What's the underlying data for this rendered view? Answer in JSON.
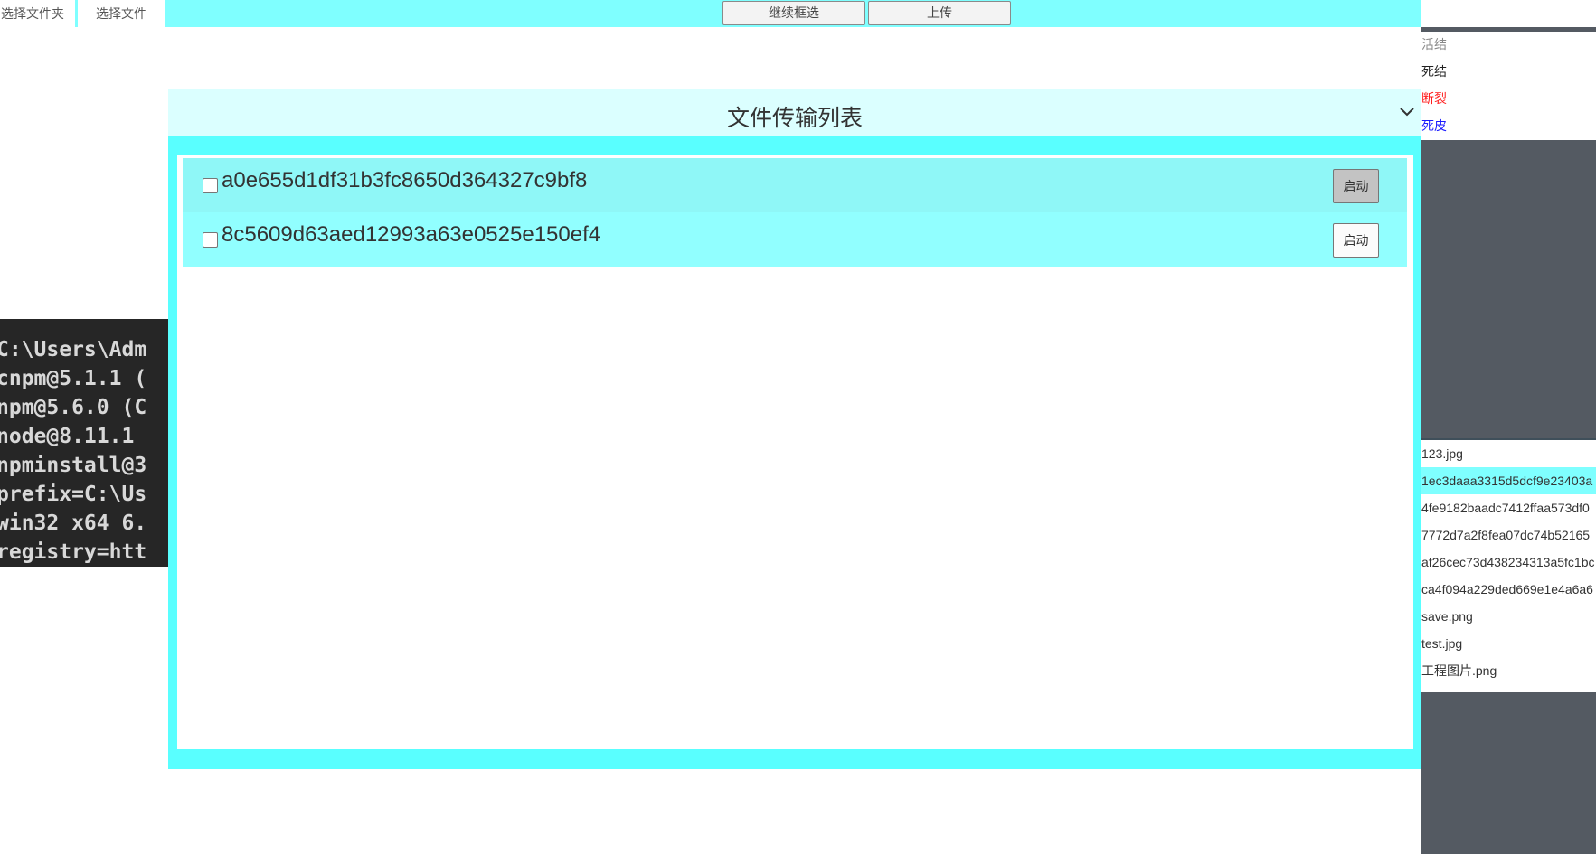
{
  "topbar": {
    "tabs": [
      "选择文件夹",
      "选择文件"
    ],
    "continue_select_label": "继续框选",
    "upload_label": "上传"
  },
  "terminal": {
    "lines": [
      "C:\\Users\\Adm",
      "cnpm@5.1.1 (",
      "npm@5.6.0 (C",
      "node@8.11.1",
      "npminstall@3",
      "prefix=C:\\Us",
      "win32 x64 6.",
      "registry=htt"
    ]
  },
  "transfer_panel": {
    "title": "文件传输列表",
    "rows": [
      {
        "name": "a0e655d1df31b3fc8650d364327c9bf8",
        "button": "启动"
      },
      {
        "name": "8c5609d63aed12993a63e0525e150ef4",
        "button": "启动"
      }
    ]
  },
  "sidebar": {
    "statuses": [
      {
        "label": "活结",
        "color": "#888888"
      },
      {
        "label": "死结",
        "color": "#222222"
      },
      {
        "label": "断裂",
        "color": "#ff1a1a"
      },
      {
        "label": "死皮",
        "color": "#1a1aff"
      }
    ],
    "files": [
      "123.jpg",
      "1ec3daaa3315d5dcf9e23403a",
      "4fe9182baadc7412ffaa573df0",
      "7772d7a2f8fea07dc74b52165",
      "af26cec73d438234313a5fc1bc",
      "ca4f094a229ded669e1e4a6a6",
      "save.png",
      "test.jpg",
      "工程图片.png"
    ],
    "selected_file_index": 1
  },
  "colors": {
    "topbar": "#7fffff",
    "panel": "#59ffff",
    "panel_header": "#dbffff",
    "sidebar": "#545a62"
  }
}
